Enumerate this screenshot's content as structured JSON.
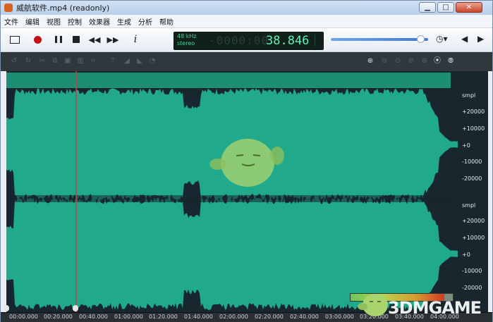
{
  "window": {
    "title": "威航软件.mp4 (readonly)"
  },
  "menu": [
    "文件",
    "编辑",
    "视图",
    "控制",
    "效果器",
    "生成",
    "分析",
    "帮助"
  ],
  "display": {
    "sample_rate": "48 kHz",
    "channels": "stereo",
    "time_dim": "-0000:00",
    "time": "38.846"
  },
  "volume": {
    "level": 0.93
  },
  "scale": {
    "unit": "smpl",
    "labels": [
      "+20000",
      "+10000",
      "+0",
      "-10000",
      "-20000"
    ]
  },
  "ruler": [
    "00:00.000",
    "00:20.000",
    "00:40.000",
    "01:00.000",
    "01:20.000",
    "01:40.000",
    "02:00.000",
    "02:20.000",
    "02:40.000",
    "03:00.000",
    "03:20.000",
    "03:40.000",
    "04:00.000"
  ],
  "watermark": {
    "text": "3DMGAME"
  },
  "colors": {
    "wave": "#20a98a",
    "wave_bg": "#17272d",
    "accent": "#5ff2b4"
  }
}
